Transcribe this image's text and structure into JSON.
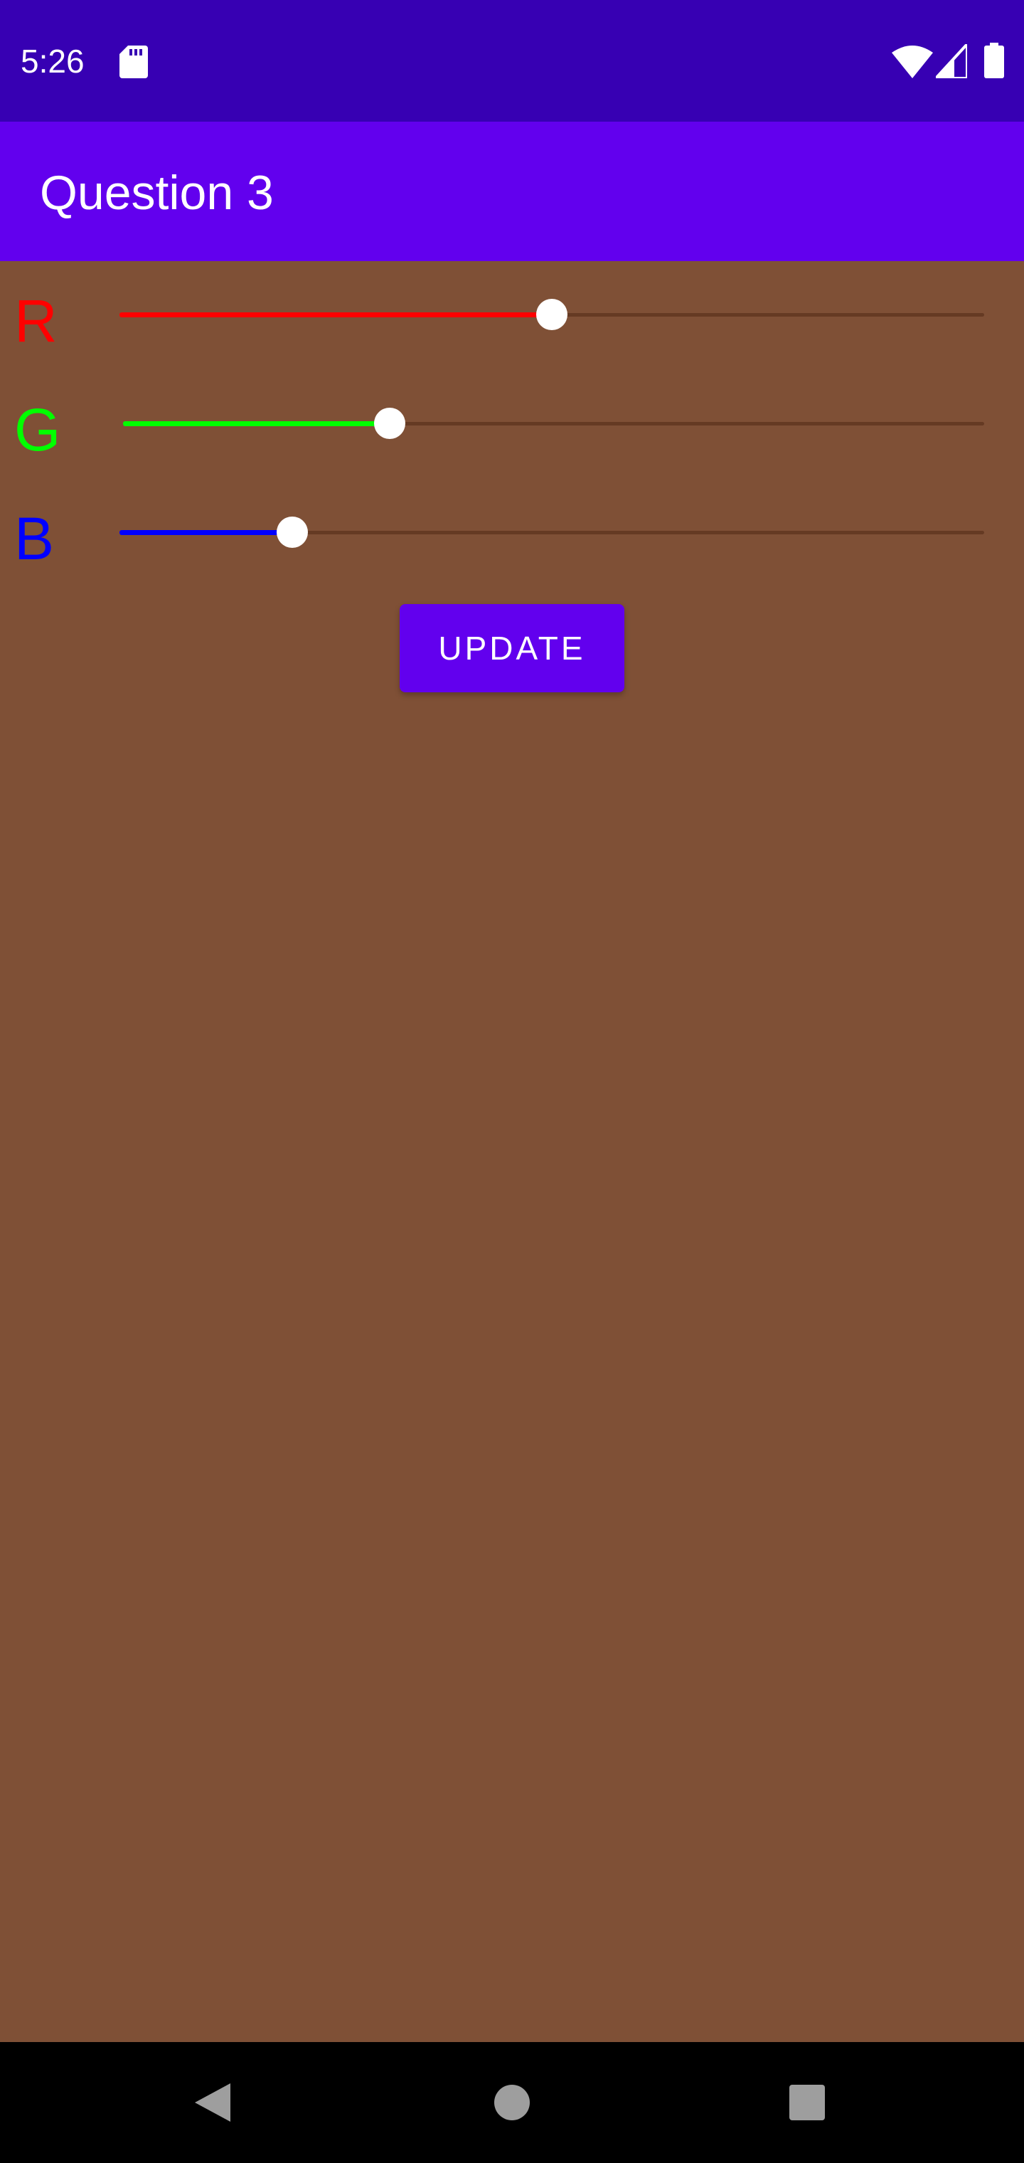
{
  "colors": {
    "status_bar_bg": "#3700B3",
    "app_bar_bg": "#6200EE",
    "content_bg": "#7F5036",
    "red": "#FF0000",
    "green": "#00FF00",
    "blue": "#0000FF",
    "button_bg": "#6200EE"
  },
  "status_bar": {
    "time": "5:26",
    "icons": [
      "sd-card-icon",
      "wifi-icon",
      "signal-icon",
      "battery-icon"
    ]
  },
  "app_bar": {
    "title": "Question 3"
  },
  "sliders": [
    {
      "label": "R",
      "color": "#FF0000",
      "fraction": 0.5
    },
    {
      "label": "G",
      "color": "#00FF00",
      "fraction": 0.31
    },
    {
      "label": "B",
      "color": "#0000FF",
      "fraction": 0.2
    }
  ],
  "update_button": {
    "label": "UPDATE"
  },
  "nav_bar": {
    "buttons": [
      "back-icon",
      "home-icon",
      "recents-icon"
    ]
  }
}
